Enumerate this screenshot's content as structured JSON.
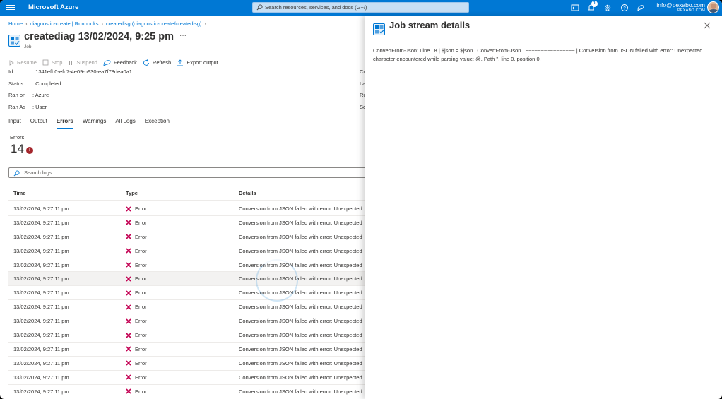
{
  "topbar": {
    "brand": "Microsoft Azure",
    "search_placeholder": "Search resources, services, and docs (G+/)",
    "notification_count": "1",
    "account_email": "info@pexabo.com",
    "account_org": "PEXABO.COM"
  },
  "breadcrumb": [
    "Home",
    "diagnostic-create | Runbooks",
    "createdisg (diagnostic-create/createdisg)"
  ],
  "header": {
    "title": "creatediag 13/02/2024, 9:25 pm",
    "subtitle": "Job",
    "more": "···"
  },
  "toolbar": {
    "resume": "Resume",
    "stop": "Stop",
    "suspend": "Suspend",
    "feedback": "Feedback",
    "refresh": "Refresh",
    "export": "Export output"
  },
  "properties": [
    {
      "key": "Id",
      "value": "1341efb0-efc7-4e09-b930-ea7f78dea0a1"
    },
    {
      "key": "Status",
      "value": "Completed"
    },
    {
      "key": "Ran on",
      "value": "Azure"
    },
    {
      "key": "Ran As",
      "value": "User"
    }
  ],
  "properties_right": [
    "Cr",
    "La",
    "Ru",
    "So"
  ],
  "tabs": [
    "Input",
    "Output",
    "Errors",
    "Warnings",
    "All Logs",
    "Exception"
  ],
  "active_tab": "Errors",
  "errors": {
    "label": "Errors",
    "count": "14",
    "icon": "!"
  },
  "log_search": {
    "placeholder": "Search logs..."
  },
  "table": {
    "headers": [
      "Time",
      "Type",
      "Details"
    ],
    "rows": [
      {
        "time": "13/02/2024, 9:27:11 pm",
        "type": "Error",
        "details": "Conversion from JSON failed with error: Unexpected"
      },
      {
        "time": "13/02/2024, 9:27:11 pm",
        "type": "Error",
        "details": "Conversion from JSON failed with error: Unexpected"
      },
      {
        "time": "13/02/2024, 9:27:11 pm",
        "type": "Error",
        "details": "Conversion from JSON failed with error: Unexpected"
      },
      {
        "time": "13/02/2024, 9:27:11 pm",
        "type": "Error",
        "details": "Conversion from JSON failed with error: Unexpected"
      },
      {
        "time": "13/02/2024, 9:27:11 pm",
        "type": "Error",
        "details": "Conversion from JSON failed with error: Unexpected"
      },
      {
        "time": "13/02/2024, 9:27:11 pm",
        "type": "Error",
        "details": "Conversion from JSON failed with error: Unexpected"
      },
      {
        "time": "13/02/2024, 9:27:11 pm",
        "type": "Error",
        "details": "Conversion from JSON failed with error: Unexpected"
      },
      {
        "time": "13/02/2024, 9:27:11 pm",
        "type": "Error",
        "details": "Conversion from JSON failed with error: Unexpected"
      },
      {
        "time": "13/02/2024, 9:27:11 pm",
        "type": "Error",
        "details": "Conversion from JSON failed with error: Unexpected"
      },
      {
        "time": "13/02/2024, 9:27:11 pm",
        "type": "Error",
        "details": "Conversion from JSON failed with error: Unexpected"
      },
      {
        "time": "13/02/2024, 9:27:11 pm",
        "type": "Error",
        "details": "Conversion from JSON failed with error: Unexpected"
      },
      {
        "time": "13/02/2024, 9:27:11 pm",
        "type": "Error",
        "details": "Conversion from JSON failed with error: Unexpected"
      },
      {
        "time": "13/02/2024, 9:27:11 pm",
        "type": "Error",
        "details": "Conversion from JSON failed with error: Unexpected"
      },
      {
        "time": "13/02/2024, 9:27:11 pm",
        "type": "Error",
        "details": "Conversion from JSON failed with error: Unexpected"
      }
    ]
  },
  "panel": {
    "title": "Job stream details",
    "body": "ConvertFrom-Json: Line | 8 | $json = $json | ConvertFrom-Json | ~~~~~~~~~~~~~~~~ | Conversion from JSON failed with error: Unexpected character encountered while parsing value: @. Path '', line 0, position 0."
  },
  "colors": {
    "accent": "#0078d4",
    "error": "#a4262c",
    "error_x": "#c30052"
  },
  "icons": [
    "menu-icon",
    "search-icon",
    "cloud-shell-icon",
    "notifications-icon",
    "settings-icon",
    "help-icon",
    "feedback-icon",
    "runbook-job-icon",
    "play-icon",
    "stop-icon",
    "pause-icon",
    "refresh-icon",
    "export-icon",
    "error-x-icon",
    "close-icon"
  ]
}
